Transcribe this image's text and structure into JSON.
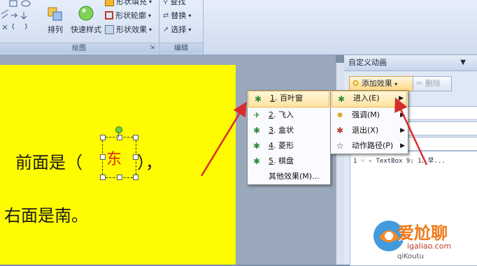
{
  "ribbon": {
    "arrange_label": "排列",
    "quick_styles_label": "快速样式",
    "shape_fill_label": "形状填充",
    "shape_outline_label": "形状轮廓",
    "shape_effects_label": "形状效果",
    "find_label": "查找",
    "replace_label": "替换",
    "select_label": "选择",
    "drawing_group": "绘图",
    "editing_group": "编辑"
  },
  "slide": {
    "line1_prefix": "前面是（",
    "highlight_char": "东",
    "line1_suffix": "），",
    "line2": "右面是南。"
  },
  "pane": {
    "title": "自定义动画",
    "add_effect_label": "添加效果",
    "delete_label": "删除",
    "list_item": "1 ☜  ✧ TextBox 9: 1、早..."
  },
  "submenu_effects": {
    "items": [
      {
        "num": "1",
        "label": ". 百叶窗",
        "icon": "star-effect-icon"
      },
      {
        "num": "2",
        "label": ". 飞入",
        "icon": "fly-in-icon"
      },
      {
        "num": "3",
        "label": ". 盒状",
        "icon": "star-effect-icon"
      },
      {
        "num": "4",
        "label": ". 菱形",
        "icon": "star-effect-icon"
      },
      {
        "num": "5",
        "label": ". 棋盘",
        "icon": "star-effect-icon"
      }
    ],
    "more_label": "其他效果(M)..."
  },
  "menu_add": {
    "items": [
      {
        "label": "进入(E)",
        "icon": "entrance-icon"
      },
      {
        "label": "强调(M)",
        "icon": "emphasis-icon"
      },
      {
        "label": "退出(X)",
        "icon": "exit-icon"
      },
      {
        "label": "动作路径(P)",
        "icon": "motion-path-icon"
      }
    ]
  },
  "watermark": {
    "brand": "爱尬聊",
    "url": "igaliao.com",
    "extra": "qiKoutu"
  },
  "colors": {
    "slide_bg": "#fffb00",
    "highlight_text": "#e02a00",
    "arrow": "#d92b2b",
    "menu_highlight": "#ffe3a0"
  }
}
